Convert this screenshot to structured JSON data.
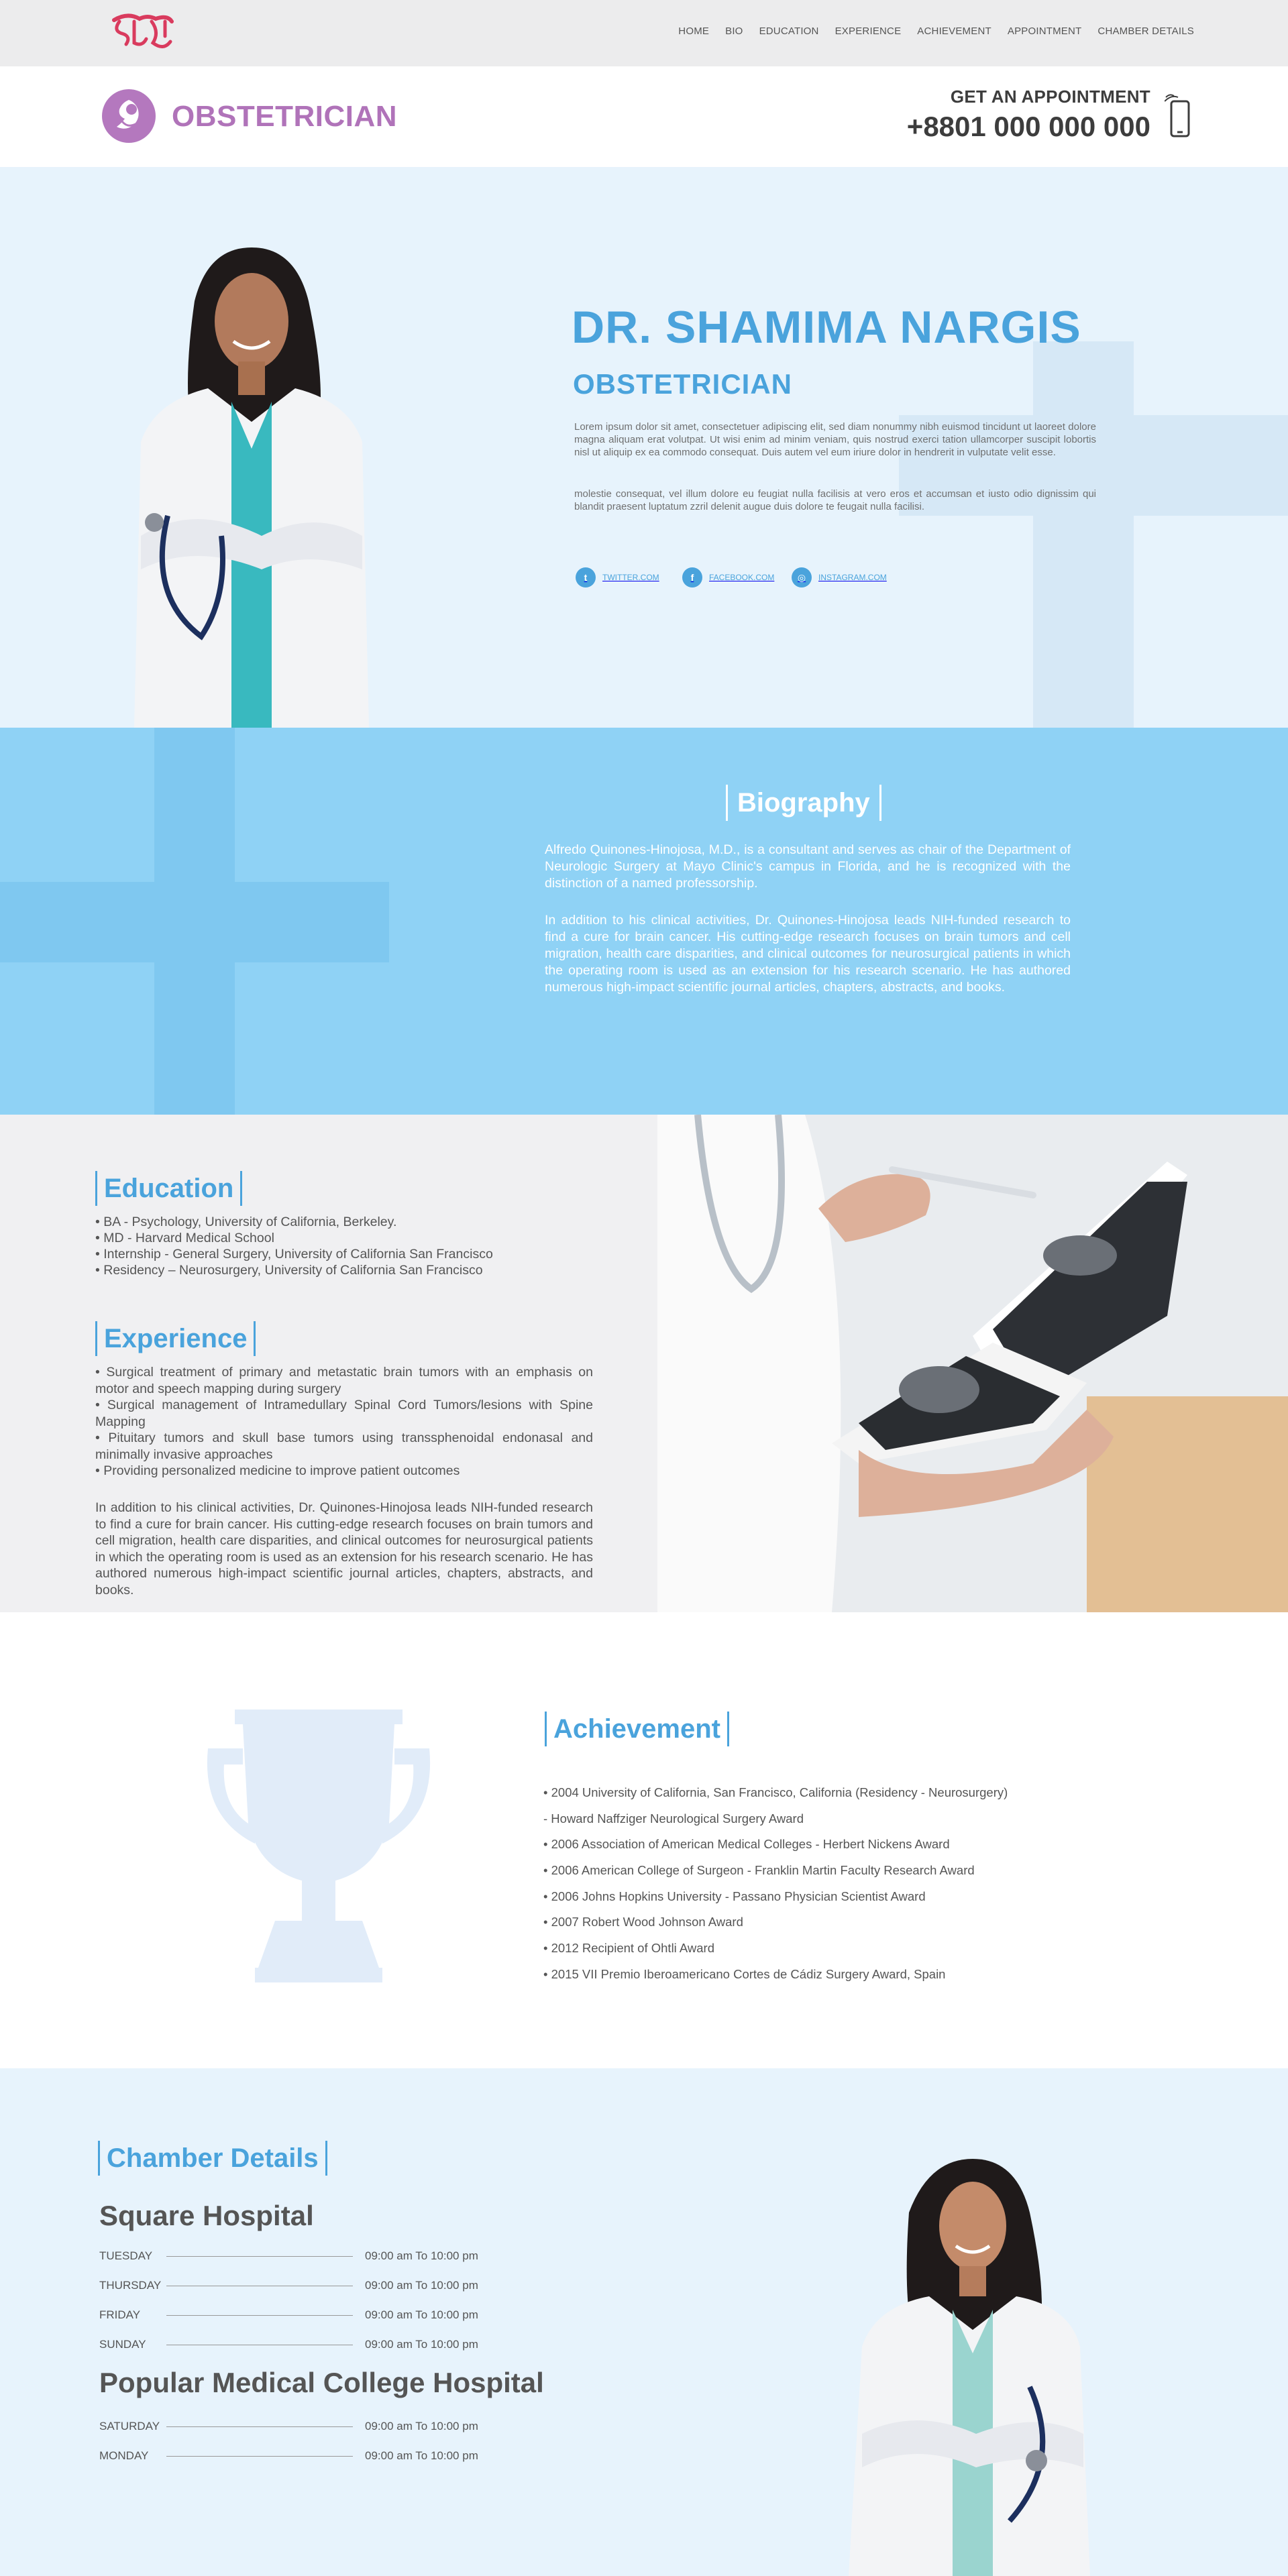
{
  "nav": {
    "logo_text": "ডাক্তার কই",
    "items": [
      "HOME",
      "BIO",
      "EDUCATION",
      "EXPERIENCE",
      "ACHIEVEMENT",
      "APPOINTMENT",
      "CHAMBER DETAILS"
    ]
  },
  "brand": {
    "name": "OBSTETRICIAN",
    "icon": "fetus-icon",
    "appointment_label": "GET AN APPOINTMENT",
    "phone": "+8801 000 000 000",
    "phone_icon": "mobile-phone-icon"
  },
  "hero": {
    "name": "DR. SHAMIMA NARGIS",
    "role": "OBSTETRICIAN",
    "paragraph1": "Lorem ipsum dolor sit amet, consectetuer adipiscing elit, sed diam nonummy nibh euismod tincidunt ut laoreet dolore magna aliquam erat volutpat. Ut wisi enim ad minim veniam, quis nostrud exerci tation ullamcorper suscipit lobortis nisl ut aliquip ex ea commodo consequat. Duis autem vel eum iriure dolor in hendrerit in vulputate velit esse.",
    "paragraph2": "molestie consequat, vel illum dolore eu feugiat nulla facilisis at vero eros et accumsan et iusto odio dignissim qui blandit praesent luptatum zzril delenit augue duis dolore te feugait nulla facilisi.",
    "social": [
      {
        "icon": "twitter-icon",
        "label": "TWITTER.COM"
      },
      {
        "icon": "facebook-icon",
        "label": "FACEBOOK.COM"
      },
      {
        "icon": "instagram-icon",
        "label": "INSTAGRAM.COM"
      }
    ]
  },
  "bio": {
    "title": "Biography",
    "paragraph1": "Alfredo Quinones-Hinojosa, M.D., is a consultant and serves as chair of the Department of Neurologic Surgery at Mayo Clinic's campus in Florida, and he is recognized with the distinction of a named professorship.",
    "paragraph2": "In addition to his clinical activities, Dr. Quinones-Hinojosa leads NIH-funded research to find a cure for brain cancer. His cutting-edge research focuses on brain tumors and cell migration, health care disparities, and clinical outcomes for neurosurgical patients in which the operating room is used as an extension for his research scenario. He has authored numerous high-impact scientific journal articles, chapters, abstracts, and books."
  },
  "education": {
    "title": "Education",
    "items": [
      "• BA - Psychology, University of California, Berkeley.",
      "• MD - Harvard Medical School",
      "• Internship - General Surgery, University of California San Francisco",
      "• Residency – Neurosurgery, University of California San Francisco"
    ]
  },
  "experience": {
    "title": "Experience",
    "items": [
      "• Surgical treatment of primary and metastatic brain tumors with an emphasis on motor and speech mapping during surgery",
      "• Surgical management of Intramedullary Spinal Cord Tumors/lesions with Spine Mapping",
      "• Pituitary tumors and skull base tumors using transsphenoidal endonasal and minimally invasive approaches",
      "• Providing personalized medicine to improve patient outcomes"
    ],
    "paragraph": "In addition to his clinical activities, Dr. Quinones-Hinojosa leads NIH-funded research to find a cure for brain cancer. His cutting-edge research focuses on brain tumors and cell migration, health care disparities, and clinical outcomes for neurosurgical patients in which the operating room is used as an extension for his research scenario. He has authored numerous high-impact scientific journal articles, chapters, abstracts, and books."
  },
  "achievement": {
    "title": "Achievement",
    "icon": "trophy-icon",
    "items": [
      "• 2004 University of California, San Francisco, California (Residency - Neurosurgery)",
      "- Howard Naffziger Neurological Surgery Award",
      "• 2006 Association of American Medical Colleges - Herbert Nickens Award",
      "• 2006 American College of Surgeon - Franklin Martin Faculty Research Award",
      "• 2006 Johns Hopkins University - Passano Physician Scientist Award",
      "• 2007 Robert Wood Johnson Award",
      "• 2012 Recipient of Ohtli Award",
      "• 2015 VII Premio Iberoamericano Cortes de Cádiz Surgery Award, Spain"
    ]
  },
  "chamber": {
    "title": "Chamber Details",
    "hospitals": [
      {
        "name": "Square Hospital",
        "schedule": [
          {
            "day": "TUESDAY",
            "time": "09:00 am To 10:00 pm"
          },
          {
            "day": "THURSDAY",
            "time": "09:00 am To 10:00 pm"
          },
          {
            "day": "FRIDAY",
            "time": "09:00 am To 10:00 pm"
          },
          {
            "day": "SUNDAY",
            "time": "09:00 am To 10:00 pm"
          }
        ]
      },
      {
        "name": "Popular Medical College Hospital",
        "schedule": [
          {
            "day": "SATURDAY",
            "time": "09:00 am To 10:00 pm"
          },
          {
            "day": "MONDAY",
            "time": "09:00 am To 10:00 pm"
          }
        ]
      }
    ]
  },
  "colors": {
    "accent_blue": "#4aa3dc",
    "brand_purple": "#b073b9",
    "hero_bg": "#e7f3fc",
    "bio_bg": "#8fd2f5"
  }
}
